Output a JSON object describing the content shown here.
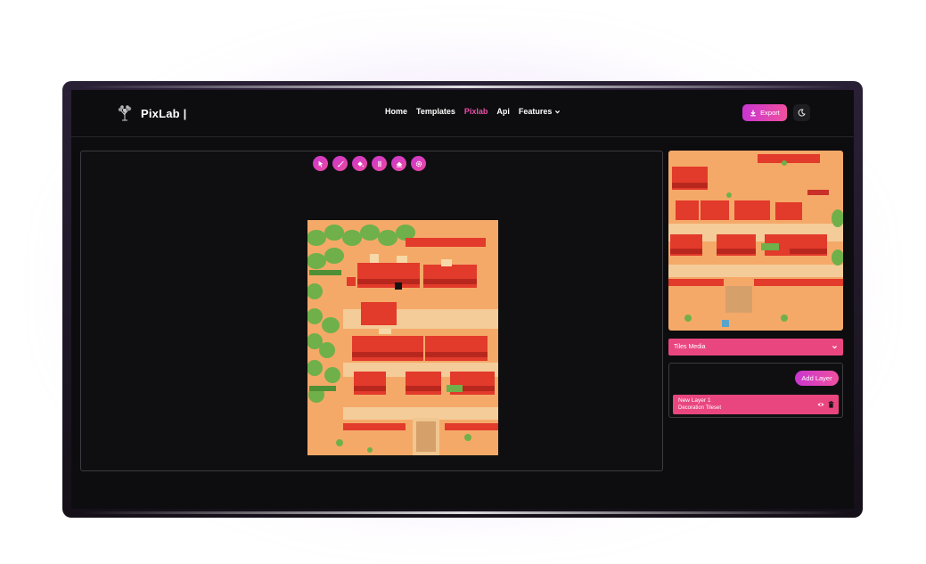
{
  "app": {
    "name": "PixLab |"
  },
  "nav": {
    "links": [
      "Home",
      "Templates",
      "Pixlab",
      "Api"
    ],
    "active": "Pixlab",
    "features_label": "Features"
  },
  "header": {
    "export_label": "Export",
    "theme_icon": "moon-icon"
  },
  "toolbar": {
    "tools": [
      "pointer-icon",
      "brush-icon",
      "fill-bucket-icon",
      "column-icon",
      "eraser-icon",
      "settings-icon"
    ]
  },
  "tiles_select": {
    "value": "Tiles Media"
  },
  "layers": {
    "add_label": "Add Layer",
    "items": [
      {
        "name": "New Layer 1",
        "tileset": "Decoration Tileset"
      }
    ]
  },
  "colors": {
    "accent_start": "#c936d0",
    "accent_end": "#f04f9e",
    "active_link": "#e94fa8",
    "layer_bg": "#e9467f"
  }
}
